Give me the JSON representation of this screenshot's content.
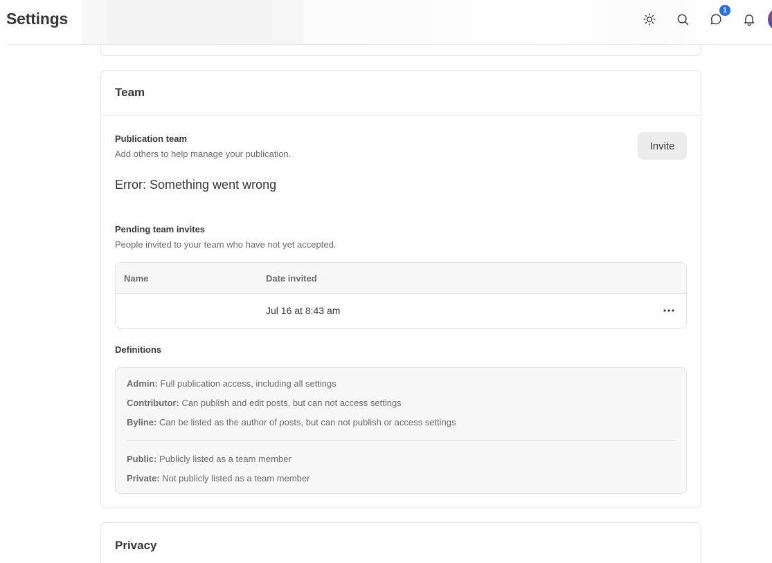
{
  "header": {
    "title": "Settings",
    "icons": [
      "sun-icon",
      "search-icon",
      "chat-icon",
      "bell-icon"
    ],
    "chat_badge": "1",
    "accent": "#1f6feb"
  },
  "team_card": {
    "title": "Team",
    "publication_team": {
      "title": "Publication team",
      "description": "Add others to help manage your publication.",
      "invite_label": "Invite",
      "error": "Error: Something went wrong"
    },
    "pending": {
      "title": "Pending team invites",
      "description": "People invited to your team who have not yet accepted.",
      "columns": [
        "Name",
        "Date invited"
      ],
      "rows": [
        {
          "name": "",
          "date": "Jul 16 at 8:43 am"
        }
      ]
    },
    "definitions": {
      "title": "Definitions",
      "roles": [
        {
          "term": "Admin:",
          "text": "Full publication access, including all settings"
        },
        {
          "term": "Contributor:",
          "text": "Can publish and edit posts, but can not access settings"
        },
        {
          "term": "Byline:",
          "text": "Can be listed as the author of posts, but can not publish or access settings"
        }
      ],
      "visibility": [
        {
          "term": "Public:",
          "text": "Publicly listed as a team member"
        },
        {
          "term": "Private:",
          "text": "Not publicly listed as a team member"
        }
      ]
    }
  },
  "privacy_card": {
    "title": "Privacy"
  }
}
